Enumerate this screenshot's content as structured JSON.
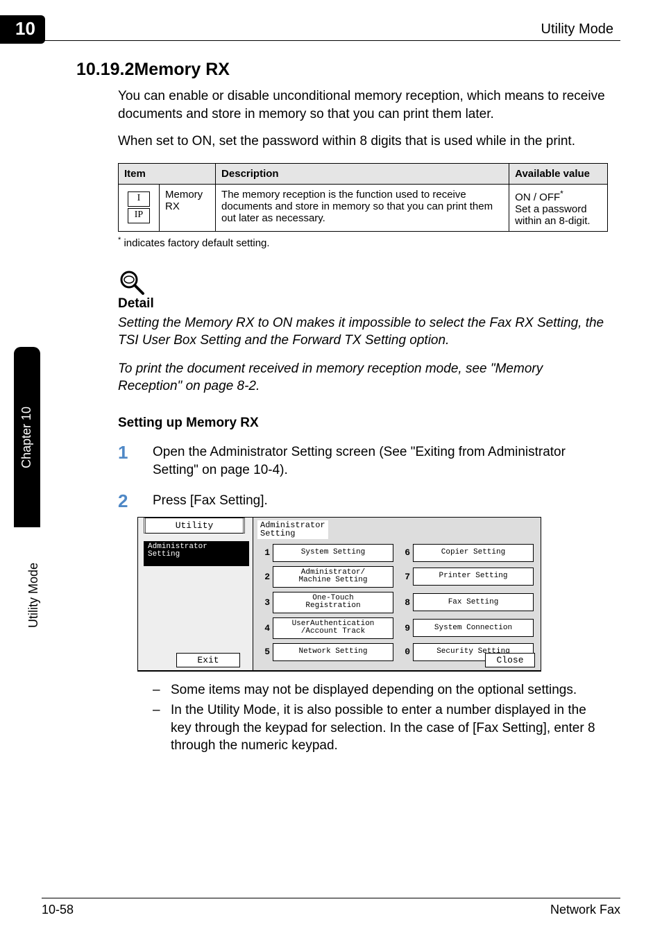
{
  "header": {
    "chapter_number": "10",
    "title_right": "Utility Mode"
  },
  "side": {
    "chapter_label": "Chapter 10",
    "mode_label": "Utility Mode"
  },
  "section": {
    "number_and_title": "10.19.2Memory RX"
  },
  "intro": {
    "p1": "You can enable or disable unconditional memory reception, which means to receive documents and store in memory so that you can print them later.",
    "p2": "When set to ON, set the password within 8 digits that is used while in the print."
  },
  "table": {
    "headers": {
      "item": "Item",
      "description": "Description",
      "available": "Available value"
    },
    "row": {
      "icon_top": "I",
      "icon_bottom": "IP",
      "name": "Memory RX",
      "description": "The memory reception is the function used to receive documents and store in memory so that you can print them out later as necessary.",
      "available_line1": "ON / OFF",
      "available_star": "*",
      "available_line2": "Set a password within an 8-digit."
    }
  },
  "footnote": "indicates factory default setting.",
  "detail": {
    "heading": "Detail",
    "p1": "Setting the Memory RX to ON makes it impossible to select the Fax RX Setting, the TSI User Box Setting and the Forward TX Setting option.",
    "p2": "To print the document received in memory reception mode, see \"Memory Reception\" on page 8-2."
  },
  "setup": {
    "heading": "Setting up Memory RX",
    "step1": {
      "num": "1",
      "text": "Open the Administrator Setting screen (See \"Exiting from Administrator Setting\" on page 10-4)."
    },
    "step2": {
      "num": "2",
      "text": "Press [Fax Setting]."
    }
  },
  "screen": {
    "utility": "Utility",
    "admin_setting_side": "Administrator\nSetting",
    "exit": "Exit",
    "title": "Administrator\nSetting",
    "buttons": {
      "b1": {
        "num": "1",
        "label": "System Setting"
      },
      "b2": {
        "num": "2",
        "label": "Administrator/\nMachine Setting"
      },
      "b3": {
        "num": "3",
        "label": "One-Touch\nRegistration"
      },
      "b4": {
        "num": "4",
        "label": "UserAuthentication\n/Account Track"
      },
      "b5": {
        "num": "5",
        "label": "Network Setting"
      },
      "b6": {
        "num": "6",
        "label": "Copier Setting"
      },
      "b7": {
        "num": "7",
        "label": "Printer Setting"
      },
      "b8": {
        "num": "8",
        "label": "Fax Setting"
      },
      "b9": {
        "num": "9",
        "label": "System Connection"
      },
      "b0": {
        "num": "0",
        "label": "Security Setting"
      }
    },
    "close": "Close"
  },
  "notes": {
    "n1": "Some items may not be displayed depending on the optional settings.",
    "n2": "In the Utility Mode, it is also possible to enter a number displayed in the key through the keypad for selection. In the case of [Fax Setting], enter 8 through the numeric keypad."
  },
  "footer": {
    "page": "10-58",
    "doc": "Network Fax"
  }
}
